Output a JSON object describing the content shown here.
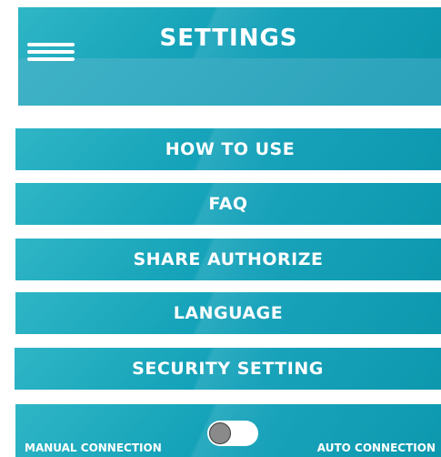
{
  "header": {
    "title": "SETTINGS"
  },
  "menu": {
    "how_to_use": "HOW TO USE",
    "faq": "FAQ",
    "share_authorize": "SHARE AUTHORIZE",
    "language": "LANGUAGE",
    "security_setting": "SECURITY SETTING"
  },
  "connection": {
    "manual_label": "MANUAL CONNECTION",
    "auto_label": "AUTO CONNECTION",
    "toggle_state": "manual"
  },
  "colors": {
    "accent": "#1aa6bb",
    "text": "#ffffff",
    "knob": "#8a8a8a"
  },
  "icons": {
    "menu": "hamburger-menu-icon"
  }
}
